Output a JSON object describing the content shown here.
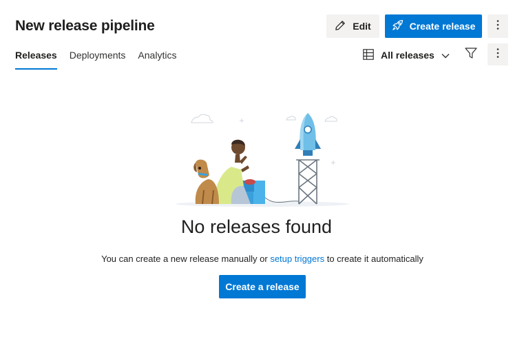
{
  "header": {
    "title": "New release pipeline",
    "edit_label": "Edit",
    "create_release_label": "Create release"
  },
  "tabs": [
    {
      "label": "Releases",
      "active": true
    },
    {
      "label": "Deployments",
      "active": false
    },
    {
      "label": "Analytics",
      "active": false
    }
  ],
  "toolbar": {
    "view_label": "All releases"
  },
  "empty_state": {
    "title": "No releases found",
    "desc_prefix": "You can create a new release manually or ",
    "desc_link": "setup triggers",
    "desc_suffix": " to create it automatically",
    "cta_label": "Create a release"
  },
  "colors": {
    "accent": "#0078d4",
    "neutral_button": "#f3f2f1"
  },
  "icons": {
    "edit": "pencil-icon",
    "create": "rocket-icon",
    "more": "more-vertical-icon",
    "view": "table-icon",
    "dropdown": "chevron-down-icon",
    "filter": "filter-icon"
  }
}
